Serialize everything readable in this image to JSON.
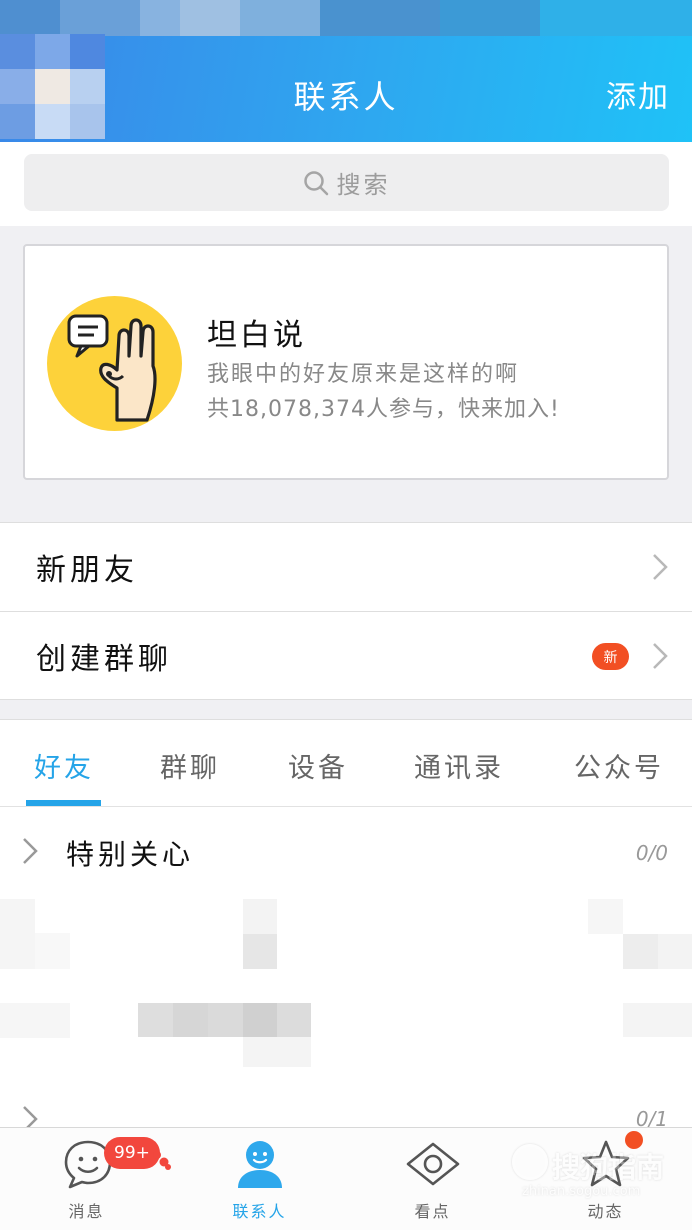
{
  "header": {
    "title": "联系人",
    "add_label": "添加"
  },
  "search": {
    "label": "搜索"
  },
  "banner": {
    "title": "坦白说",
    "subtitle": "我眼中的好友原来是这样的啊",
    "participants": "共18,078,374人参与，快来加入!"
  },
  "rows": {
    "new_friends": "新朋友",
    "create_group": "创建群聊",
    "new_badge": "新"
  },
  "tabs": [
    "好友",
    "群聊",
    "设备",
    "通讯录",
    "公众号"
  ],
  "active_tab": "好友",
  "groups": [
    {
      "label": "特别关心",
      "count": "0/0"
    },
    {
      "label": "",
      "count": "0/1"
    }
  ],
  "bottom_nav": {
    "items": [
      "消息",
      "联系人",
      "看点",
      "动态"
    ],
    "active": "联系人",
    "message_badge": "99+"
  },
  "watermark": {
    "main": "搜狗指南",
    "sub": "zhinan.sogou.com"
  },
  "colors": {
    "accent": "#25a4e8",
    "badge_red": "#f24f23",
    "header_start": "#3a86e8",
    "header_end": "#1fc2f7"
  }
}
